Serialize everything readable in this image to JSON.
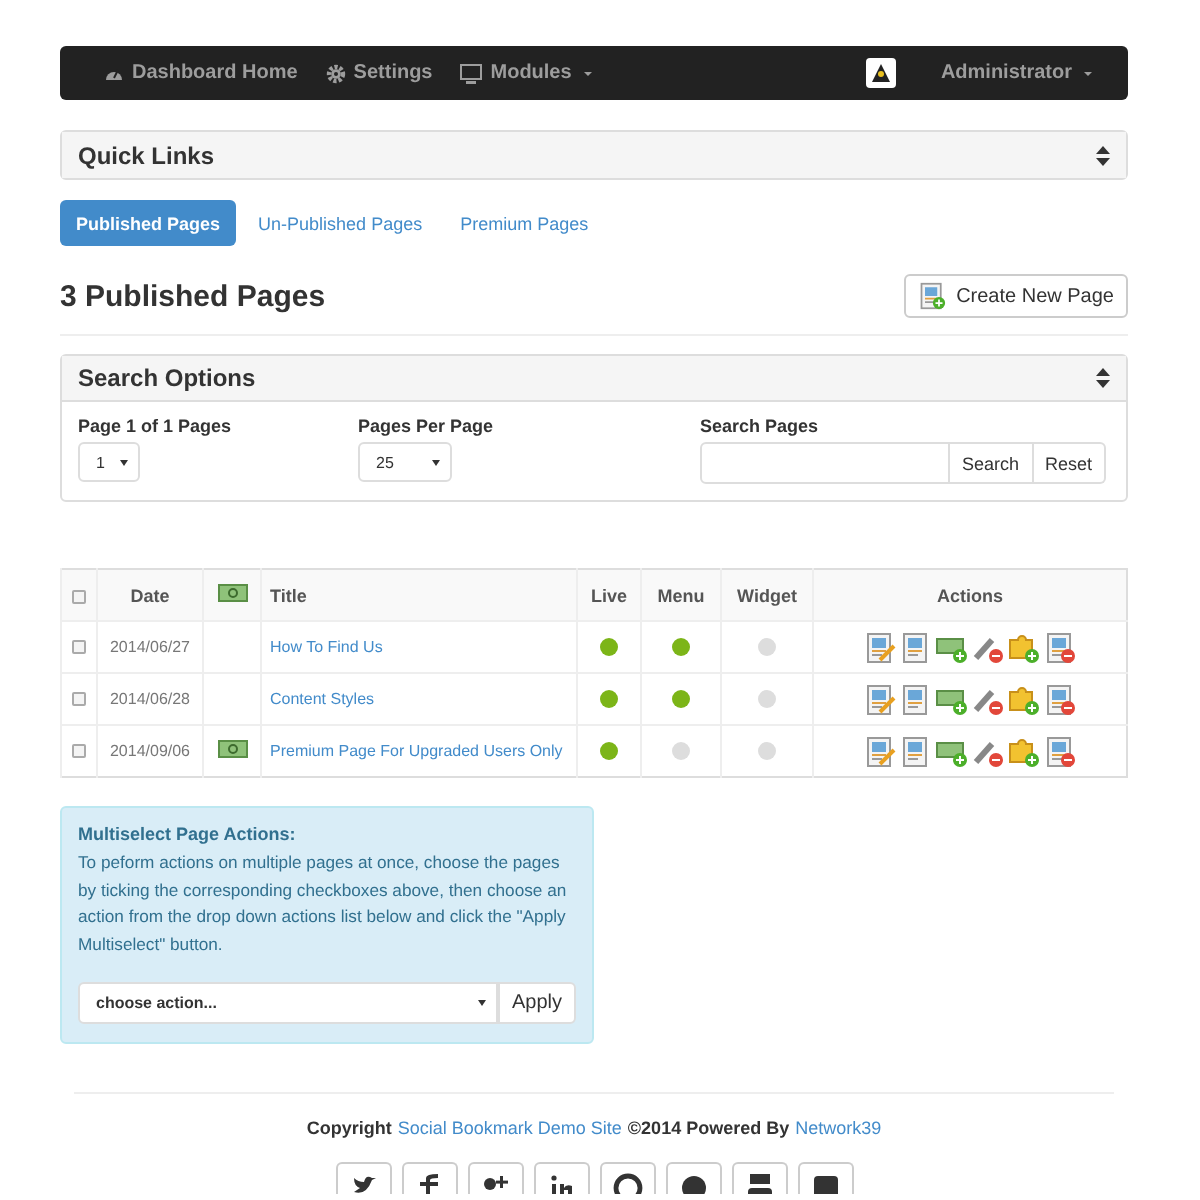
{
  "navbar": {
    "items": [
      {
        "label": "Dashboard Home",
        "dropdown": false
      },
      {
        "label": "Settings",
        "dropdown": false
      },
      {
        "label": "Modules",
        "dropdown": true
      }
    ],
    "user": {
      "label": "Administrator",
      "dropdown": true
    }
  },
  "quick_links": {
    "title": "Quick Links"
  },
  "tabs": [
    {
      "label": "Published Pages",
      "selected": true
    },
    {
      "label": "Un-Published Pages",
      "selected": false
    },
    {
      "label": "Premium Pages",
      "selected": false
    }
  ],
  "heading": "3 Published Pages",
  "create_button": "Create New Page",
  "search_options": {
    "title": "Search Options",
    "page_label": "Page 1 of 1 Pages",
    "page_value": "1",
    "per_page_label": "Pages Per Page",
    "per_page_value": "25",
    "search_label": "Search Pages",
    "search_button": "Search",
    "reset_button": "Reset"
  },
  "table": {
    "columns": [
      "Date",
      "Title",
      "Live",
      "Menu",
      "Widget",
      "Actions"
    ],
    "header_checked": false,
    "rows": [
      {
        "checked": false,
        "date": "2014/06/27",
        "premium": false,
        "title": "How To Find Us",
        "live": true,
        "menu": true,
        "widget": false
      },
      {
        "checked": false,
        "date": "2014/06/28",
        "premium": false,
        "title": "Content Styles",
        "live": true,
        "menu": true,
        "widget": false
      },
      {
        "checked": false,
        "date": "2014/09/06",
        "premium": true,
        "title": "Premium Page For Upgraded Users Only",
        "live": true,
        "menu": false,
        "widget": false
      }
    ]
  },
  "multiselect": {
    "title": "Multiselect Page Actions:",
    "text": "To peform actions on multiple pages at once, choose the pages by ticking the corresponding checkboxes above, then choose an action from the drop down actions list below and click the \"Apply Multiselect\" button.",
    "select_placeholder": "choose action...",
    "apply_button": "Apply"
  },
  "footer": {
    "segments": [
      {
        "kind": "text",
        "text": "Copyright"
      },
      {
        "kind": "link",
        "text": "Social Bookmark Demo Site"
      },
      {
        "kind": "text",
        "text": "©2014 Powered By"
      },
      {
        "kind": "link",
        "text": "Network39"
      }
    ]
  }
}
